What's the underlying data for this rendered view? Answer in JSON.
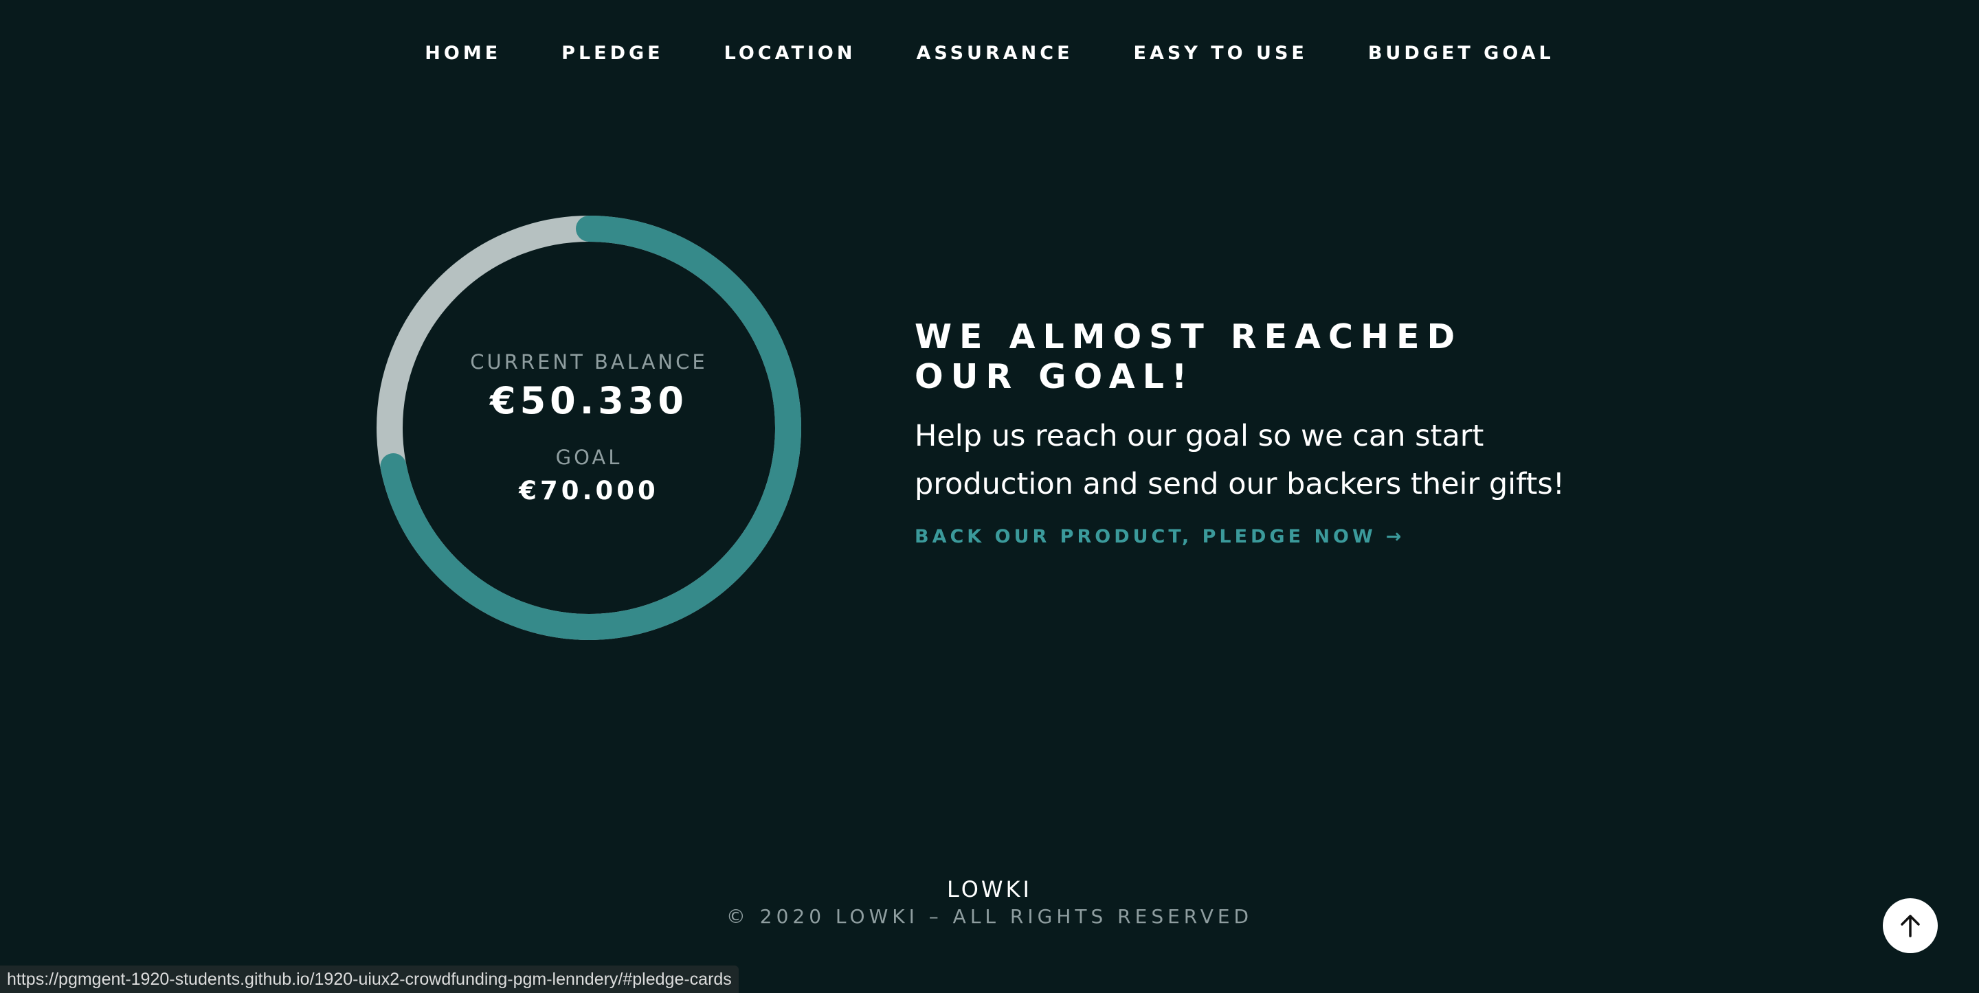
{
  "nav": {
    "items": [
      {
        "label": "HOME"
      },
      {
        "label": "PLEDGE"
      },
      {
        "label": "LOCATION"
      },
      {
        "label": "ASSURANCE"
      },
      {
        "label": "EASY TO USE"
      },
      {
        "label": "BUDGET GOAL"
      }
    ]
  },
  "budget": {
    "current_label": "CURRENT BALANCE",
    "current_value": "€50.330",
    "goal_label": "GOAL",
    "goal_value": "€70.000",
    "progress_fraction": 0.719,
    "colors": {
      "progress": "#368a8a",
      "track": "#b6c1c1"
    }
  },
  "copy": {
    "headline": "WE ALMOST REACHED OUR GOAL!",
    "subtext": "Help us reach our goal so we can start production and send our backers their gifts!",
    "cta_label": "BACK OUR PRODUCT, PLEDGE NOW",
    "cta_arrow": "→"
  },
  "footer": {
    "logo": "LOWKI",
    "copyright": "© 2020 LOWKI – ALL RIGHTS RESERVED"
  },
  "back_to_top": {
    "icon": "arrow-up-icon"
  },
  "status_bar": {
    "url": "https://pgmgent-1920-students.github.io/1920-uiux2-crowdfunding-pgm-lenndery/#pledge-cards"
  }
}
